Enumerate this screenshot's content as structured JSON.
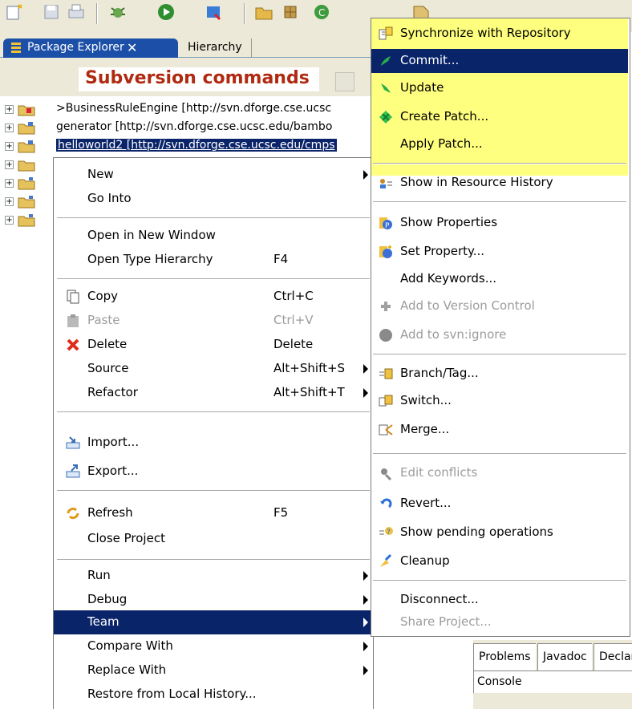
{
  "explorer": {
    "tab_active": "Package Explorer",
    "tab_hierarchy": "Hierarchy",
    "close_glyph": "✕",
    "annotation": "Subversion commands"
  },
  "tree": [
    {
      "label": ">BusinessRuleEngine [http://svn.dforge.cse.ucsc",
      "selected": false
    },
    {
      "label": "generator [http://svn.dforge.cse.ucsc.edu/bambo",
      "selected": false
    },
    {
      "label": "helloworld2 [http://svn.dforge.cse.ucsc.edu/cmps",
      "selected": true
    },
    {
      "label": "",
      "selected": false
    },
    {
      "label": "",
      "selected": false
    },
    {
      "label": "",
      "selected": false
    },
    {
      "label": "",
      "selected": false
    }
  ],
  "context_menu": {
    "new": "New",
    "go_into": "Go Into",
    "open_new_window": "Open in New Window",
    "open_type_hierarchy": "Open Type Hierarchy",
    "open_type_hierarchy_acc": "F4",
    "copy": "Copy",
    "copy_acc": "Ctrl+C",
    "paste": "Paste",
    "paste_acc": "Ctrl+V",
    "delete": "Delete",
    "delete_acc": "Delete",
    "source": "Source",
    "source_acc": "Alt+Shift+S",
    "refactor": "Refactor",
    "refactor_acc": "Alt+Shift+T",
    "import": "Import...",
    "export": "Export...",
    "refresh": "Refresh",
    "refresh_acc": "F5",
    "close_project": "Close Project",
    "run": "Run",
    "debug": "Debug",
    "team": "Team",
    "compare_with": "Compare With",
    "replace_with": "Replace With",
    "restore": "Restore from Local History..."
  },
  "team_menu": {
    "synchronize": "Synchronize with Repository",
    "commit": "Commit...",
    "update": "Update",
    "create_patch": "Create Patch...",
    "apply_patch": "Apply Patch...",
    "show_resource_history": "Show in Resource History",
    "show_properties": "Show Properties",
    "set_property": "Set Property...",
    "add_keywords": "Add Keywords...",
    "add_version_control": "Add to Version Control",
    "add_svn_ignore": "Add to svn:ignore",
    "branch_tag": "Branch/Tag...",
    "switch": "Switch...",
    "merge": "Merge...",
    "edit_conflicts": "Edit conflicts",
    "revert": "Revert...",
    "show_pending": "Show pending operations",
    "cleanup": "Cleanup",
    "disconnect": "Disconnect...",
    "share_project": "Share Project..."
  },
  "bottom_views": {
    "problems": "Problems",
    "javadoc": "Javadoc",
    "declaration": "Declaration",
    "console": "Console"
  },
  "colors": {
    "highlight": "#0a246a",
    "subversion_highlight": "#ffff7f",
    "annotation_text": "#b02a12"
  }
}
